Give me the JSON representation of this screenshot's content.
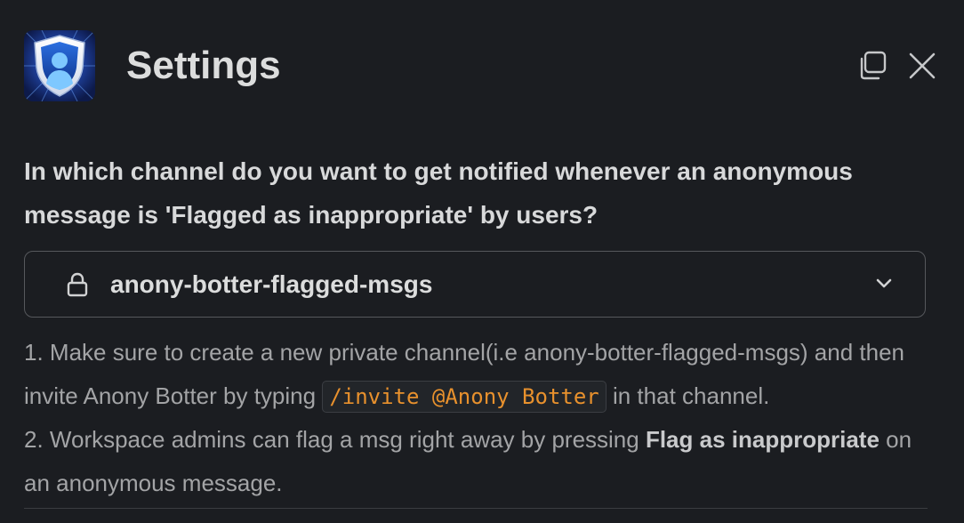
{
  "header": {
    "title": "Settings",
    "app_icon": "shield-user-icon",
    "copy_icon": "copy-icon",
    "close_icon": "close-icon"
  },
  "question": {
    "text": "In which channel do you want to get notified whenever an anonymous message is 'Flagged as inappropriate' by users?"
  },
  "channel_select": {
    "icon": "lock-icon",
    "value": "anony-botter-flagged-msgs",
    "chevron_icon": "chevron-down-icon"
  },
  "help": {
    "line1_prefix": "1. Make sure to create a new private channel(i.e anony-botter-flagged-msgs) and then invite Anony Botter by typing ",
    "line1_code": "/invite @Anony Botter",
    "line1_suffix": " in that channel.",
    "line2_prefix": "2. Workspace admins can flag a msg right away by pressing ",
    "line2_bold": "Flag as inappropriate",
    "line2_suffix": " on an anonymous message."
  },
  "colors": {
    "background": "#1b1d21",
    "code_text": "#e8912d",
    "border": "#56585c"
  }
}
